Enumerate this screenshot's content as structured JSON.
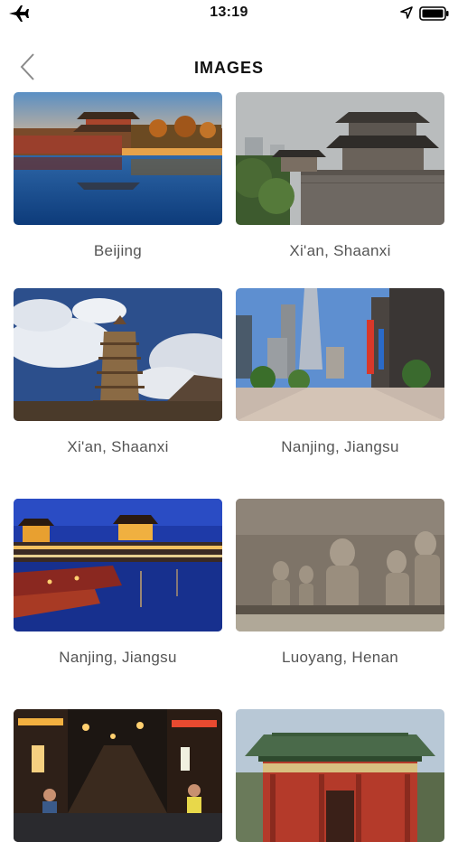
{
  "status_bar": {
    "time": "13:19"
  },
  "header": {
    "title": "IMAGES"
  },
  "images": [
    {
      "caption": "Beijing"
    },
    {
      "caption": "Xi'an, Shaanxi"
    },
    {
      "caption": "Xi'an, Shaanxi"
    },
    {
      "caption": "Nanjing, Jiangsu"
    },
    {
      "caption": "Nanjing, Jiangsu"
    },
    {
      "caption": "Luoyang, Henan"
    },
    {
      "caption": ""
    },
    {
      "caption": ""
    }
  ]
}
